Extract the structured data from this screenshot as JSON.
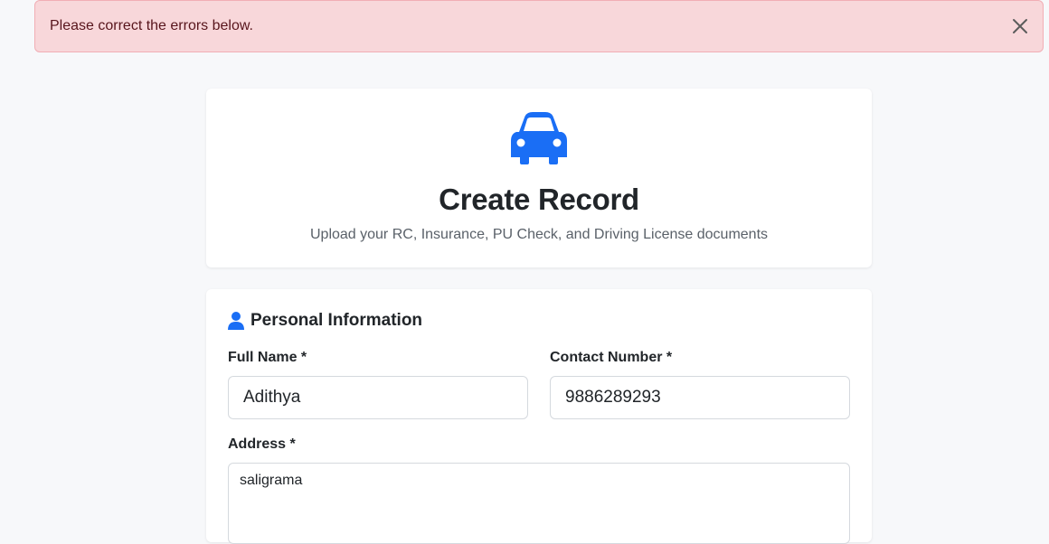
{
  "alert": {
    "message": "Please correct the errors below.",
    "close_icon": "close-icon"
  },
  "header": {
    "icon": "car-icon",
    "title": "Create Record",
    "subtitle": "Upload your RC, Insurance, PU Check, and Driving License documents",
    "accent_color": "#1a6ef5"
  },
  "personal_info": {
    "icon": "person-icon",
    "title": "Personal Information",
    "full_name": {
      "label": "Full Name *",
      "value": "Adithya"
    },
    "contact_number": {
      "label": "Contact Number *",
      "value": "9886289293"
    },
    "address": {
      "label": "Address *",
      "value": "saligrama"
    }
  }
}
